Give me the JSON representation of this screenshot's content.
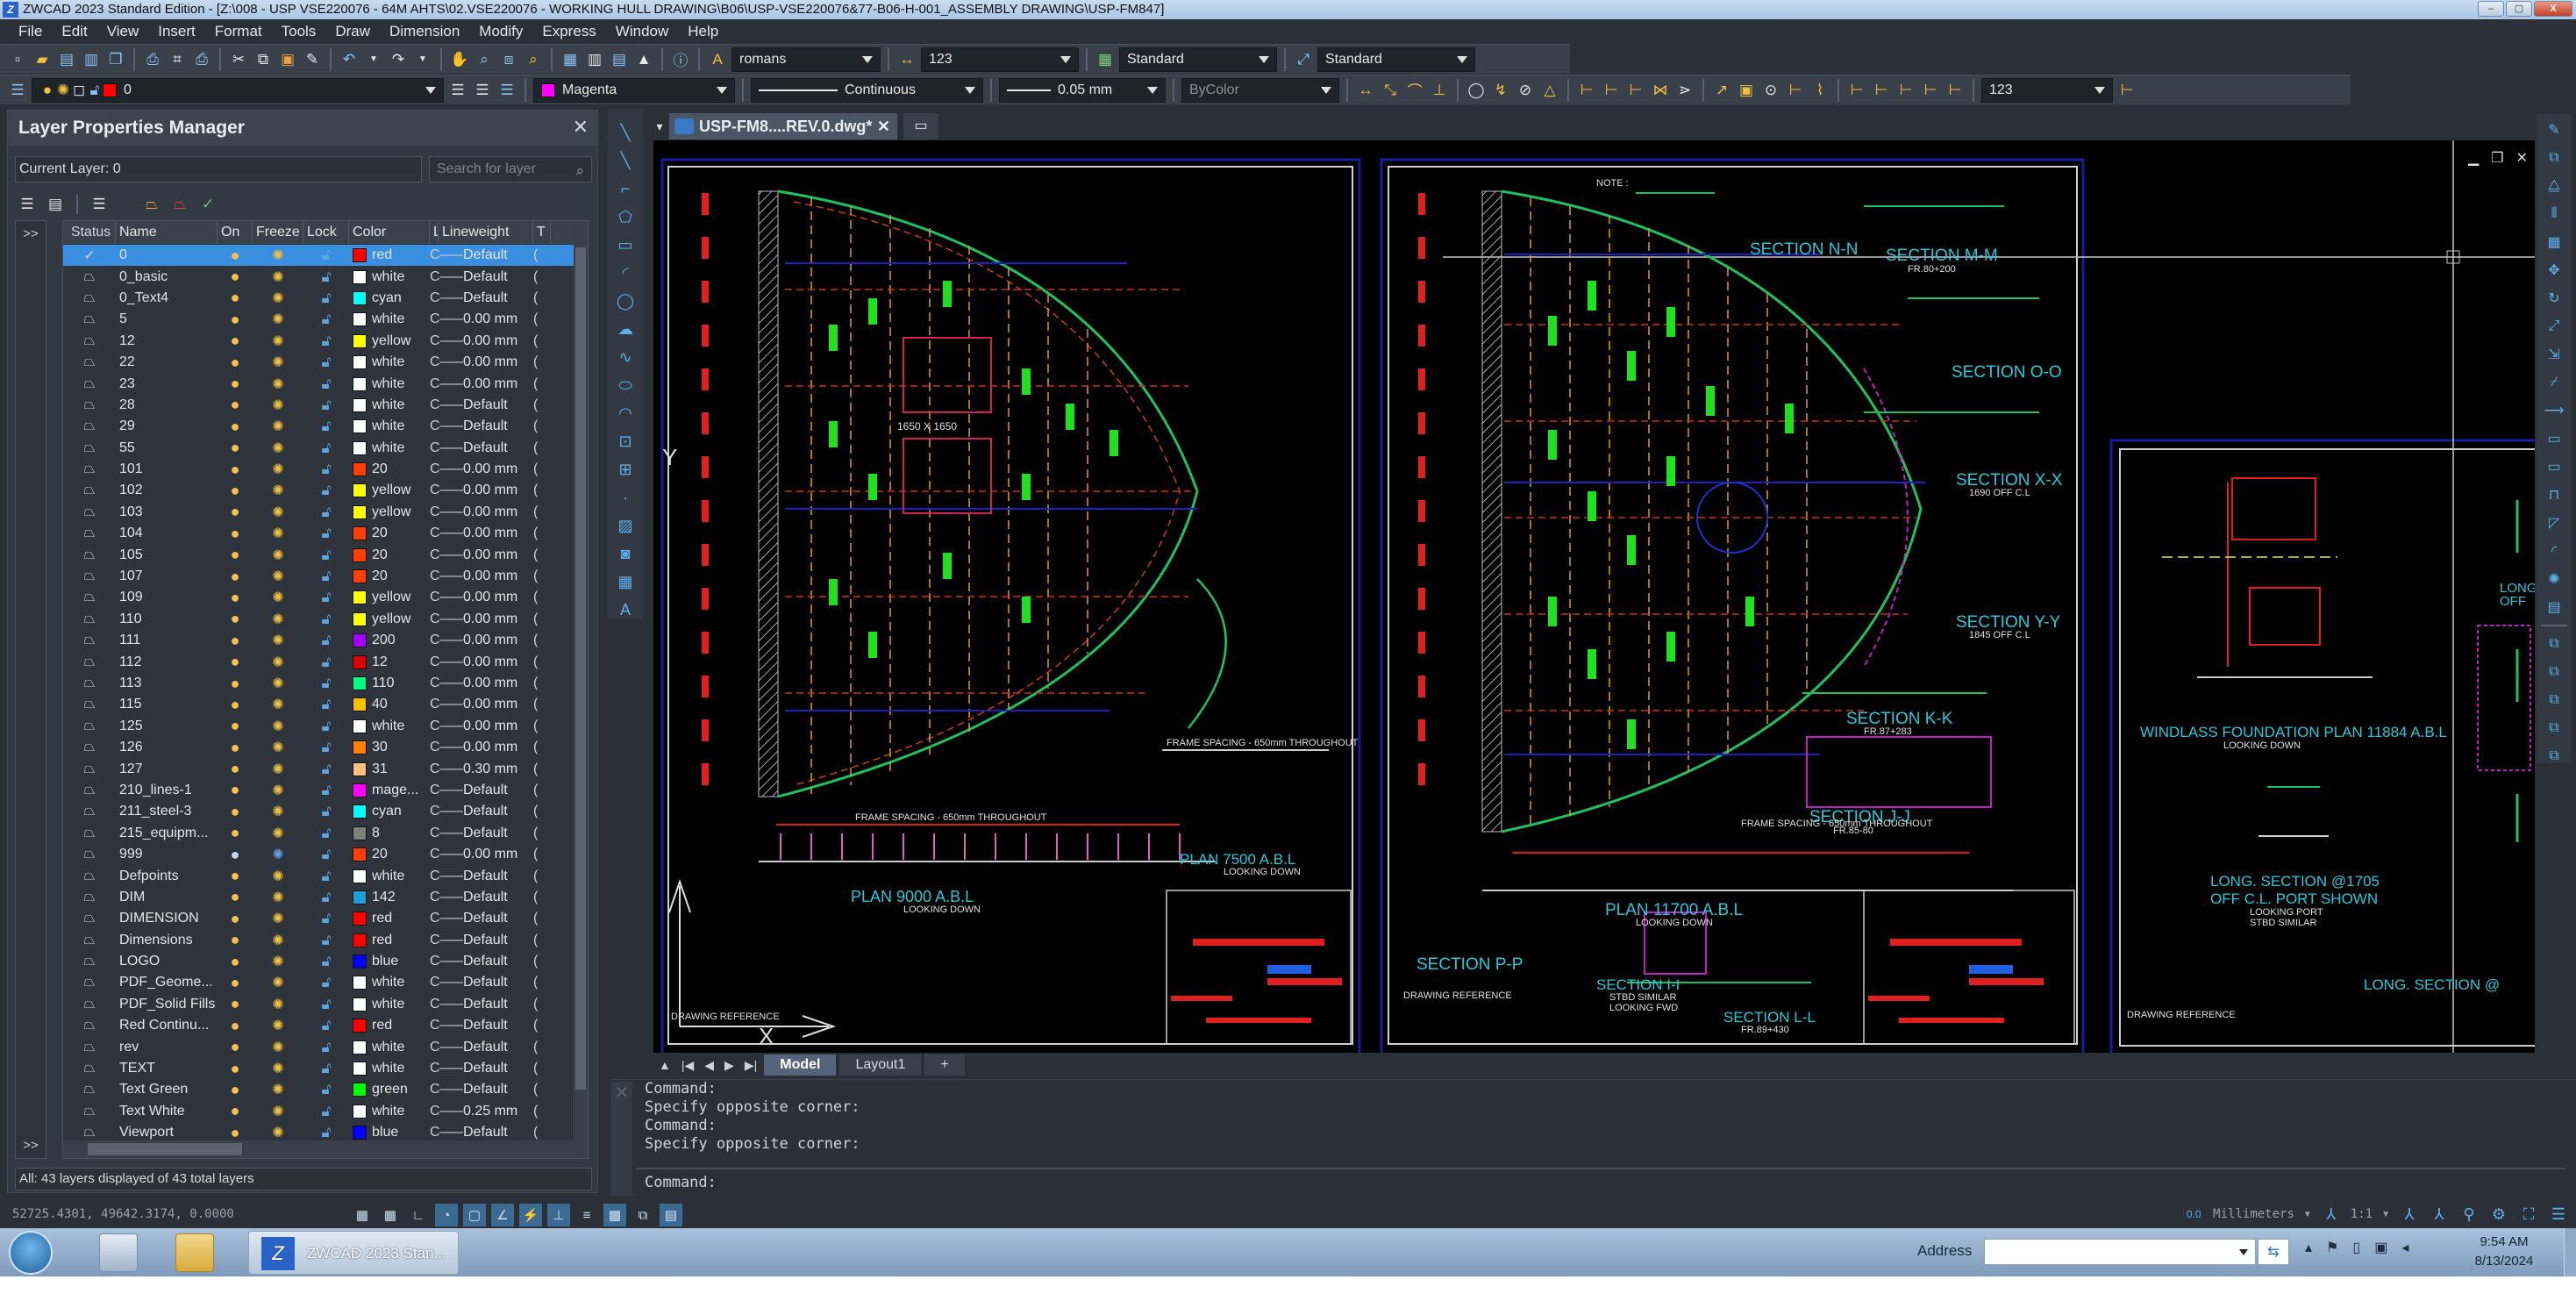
{
  "window": {
    "title": "ZWCAD 2023 Standard Edition - [Z:\\008 - USP VSE220076 - 64M AHTS\\02.VSE220076 - WORKING HULL DRAWING\\B06\\USP-VSE220076&77-B06-H-001_ASSEMBLY DRAWING\\USP-FM847]",
    "minimize": "–",
    "restore": "▢",
    "close": "X"
  },
  "menu": [
    "File",
    "Edit",
    "View",
    "Insert",
    "Format",
    "Tools",
    "Draw",
    "Dimension",
    "Modify",
    "Express",
    "Window",
    "Help"
  ],
  "toolbar1": {
    "text_style": "romans",
    "dim_style": "123",
    "table_style": "Standard",
    "mleader_style": "Standard"
  },
  "toolbar2": {
    "layer_combo": "0",
    "color_combo": "Magenta",
    "color_hex": "#ff00ff",
    "linetype_combo": "Continuous",
    "lineweight_combo": "0.05 mm",
    "plotstyle_combo": "ByColor",
    "dim_style2": "123"
  },
  "layer_panel": {
    "title": "Layer Properties Manager",
    "close": "✕",
    "current_layer": "Current Layer: 0",
    "search_placeholder": "Search for layer",
    "expand": ">>",
    "columns": [
      "Status",
      "Name",
      "On",
      "Freeze",
      "Lock",
      "Color",
      "Li",
      "Lineweight",
      "T"
    ],
    "footer": "All: 43 layers displayed of 43 total layers",
    "layers": [
      {
        "name": "0",
        "color": "red",
        "hex": "#ff0000",
        "lineweight": "Default",
        "current": true,
        "on": true
      },
      {
        "name": "0_basic",
        "color": "white",
        "hex": "#ffffff",
        "lineweight": "Default",
        "on": true
      },
      {
        "name": "0_Text4",
        "color": "cyan",
        "hex": "#00ffff",
        "lineweight": "Default",
        "on": true
      },
      {
        "name": "5",
        "color": "white",
        "hex": "#ffffff",
        "lineweight": "0.00 mm",
        "on": true
      },
      {
        "name": "12",
        "color": "yellow",
        "hex": "#ffff00",
        "lineweight": "0.00 mm",
        "on": true
      },
      {
        "name": "22",
        "color": "white",
        "hex": "#ffffff",
        "lineweight": "0.00 mm",
        "on": true
      },
      {
        "name": "23",
        "color": "white",
        "hex": "#ffffff",
        "lineweight": "0.00 mm",
        "on": true
      },
      {
        "name": "28",
        "color": "white",
        "hex": "#ffffff",
        "lineweight": "Default",
        "on": true
      },
      {
        "name": "29",
        "color": "white",
        "hex": "#ffffff",
        "lineweight": "Default",
        "on": true
      },
      {
        "name": "55",
        "color": "white",
        "hex": "#ffffff",
        "lineweight": "Default",
        "on": true
      },
      {
        "name": "101",
        "color": "20",
        "hex": "#ff3f00",
        "lineweight": "0.00 mm",
        "on": true
      },
      {
        "name": "102",
        "color": "yellow",
        "hex": "#ffff00",
        "lineweight": "0.00 mm",
        "on": true
      },
      {
        "name": "103",
        "color": "yellow",
        "hex": "#ffff00",
        "lineweight": "0.00 mm",
        "on": true
      },
      {
        "name": "104",
        "color": "20",
        "hex": "#ff3f00",
        "lineweight": "0.00 mm",
        "on": true
      },
      {
        "name": "105",
        "color": "20",
        "hex": "#ff3f00",
        "lineweight": "0.00 mm",
        "on": true
      },
      {
        "name": "107",
        "color": "20",
        "hex": "#ff3f00",
        "lineweight": "0.00 mm",
        "on": true
      },
      {
        "name": "109",
        "color": "yellow",
        "hex": "#ffff00",
        "lineweight": "0.00 mm",
        "on": true
      },
      {
        "name": "110",
        "color": "yellow",
        "hex": "#ffff00",
        "lineweight": "0.00 mm",
        "on": true
      },
      {
        "name": "111",
        "color": "200",
        "hex": "#a000ff",
        "lineweight": "0.00 mm",
        "on": true
      },
      {
        "name": "112",
        "color": "12",
        "hex": "#dd0000",
        "lineweight": "0.00 mm",
        "on": true
      },
      {
        "name": "113",
        "color": "110",
        "hex": "#00ff7f",
        "lineweight": "0.00 mm",
        "on": true
      },
      {
        "name": "115",
        "color": "40",
        "hex": "#ffbf00",
        "lineweight": "0.00 mm",
        "on": true
      },
      {
        "name": "125",
        "color": "white",
        "hex": "#ffffff",
        "lineweight": "0.00 mm",
        "on": true
      },
      {
        "name": "126",
        "color": "30",
        "hex": "#ff7f00",
        "lineweight": "0.00 mm",
        "on": true
      },
      {
        "name": "127",
        "color": "31",
        "hex": "#ffbf7f",
        "lineweight": "0.30 mm",
        "on": true
      },
      {
        "name": "210_lines-1",
        "color": "mage...",
        "hex": "#ff00ff",
        "lineweight": "Default",
        "on": true
      },
      {
        "name": "211_steel-3",
        "color": "cyan",
        "hex": "#00ffff",
        "lineweight": "Default",
        "on": true
      },
      {
        "name": "215_equipm...",
        "color": "8",
        "hex": "#808080",
        "lineweight": "Default",
        "on": true
      },
      {
        "name": "999",
        "color": "20",
        "hex": "#ff3f00",
        "lineweight": "0.00 mm",
        "on": false
      },
      {
        "name": "Defpoints",
        "color": "white",
        "hex": "#ffffff",
        "lineweight": "Default",
        "on": true
      },
      {
        "name": "DIM",
        "color": "142",
        "hex": "#1f9fd9",
        "lineweight": "Default",
        "on": true
      },
      {
        "name": "DIMENSION",
        "color": "red",
        "hex": "#ff0000",
        "lineweight": "Default",
        "on": true
      },
      {
        "name": "Dimensions",
        "color": "red",
        "hex": "#ff0000",
        "lineweight": "Default",
        "on": true
      },
      {
        "name": "LOGO",
        "color": "blue",
        "hex": "#0000ff",
        "lineweight": "Default",
        "on": true
      },
      {
        "name": "PDF_Geome...",
        "color": "white",
        "hex": "#ffffff",
        "lineweight": "Default",
        "on": true
      },
      {
        "name": "PDF_Solid Fills",
        "color": "white",
        "hex": "#ffffff",
        "lineweight": "Default",
        "on": true
      },
      {
        "name": "Red Continu...",
        "color": "red",
        "hex": "#ff0000",
        "lineweight": "Default",
        "on": true
      },
      {
        "name": "rev",
        "color": "white",
        "hex": "#ffffff",
        "lineweight": "Default",
        "on": true
      },
      {
        "name": "TEXT",
        "color": "white",
        "hex": "#ffffff",
        "lineweight": "Default",
        "on": true
      },
      {
        "name": "Text Green",
        "color": "green",
        "hex": "#00ff00",
        "lineweight": "Default",
        "on": true
      },
      {
        "name": "Text White",
        "color": "white",
        "hex": "#ffffff",
        "lineweight": "0.25 mm",
        "on": true
      },
      {
        "name": "Viewport",
        "color": "blue",
        "hex": "#0000ff",
        "lineweight": "Default",
        "on": true
      }
    ]
  },
  "document_tab": {
    "label": "USP-FM8....REV.0.dwg*",
    "close": "✕"
  },
  "drawing": {
    "note_title": "NOTE :",
    "labels_left_sheet": [
      "PLAN 9000 A.B.L",
      "LOOKING DOWN",
      "PLAN 7500 A.B.L",
      "LOOKING DOWN",
      "FRAME SPACING - 650mm THROUGHOUT",
      "DRAWING REFERENCE",
      "1650 X 1650"
    ],
    "labels_middle_sheet": [
      "SECTION N-N",
      "SECTION M-M",
      "FR.80+200",
      "SECTION O-O",
      "SECTION X-X",
      "1690 OFF C.L",
      "SECTION Y-Y",
      "1845 OFF C.L",
      "SECTION K-K",
      "FR.87+283",
      "SECTION J-J",
      "FR.85-80",
      "PLAN 11700 A.B.L",
      "LOOKING DOWN",
      "SECTION P-P",
      "SECTION I-I",
      "STBD SIMILAR",
      "LOOKING FWD",
      "SECTION L-L",
      "FR.89+430",
      "DRAWING REFERENCE"
    ],
    "labels_right_sheet": [
      "WINDLASS FOUNDATION PLAN 11884 A.B.L",
      "LOOKING DOWN",
      "LONG. SECTION @1705",
      "OFF C.L. PORT SHOWN",
      "LOOKING PORT",
      "STBD SIMILAR",
      "LONG. SECTION @",
      "LONG",
      "OFF",
      "DRAWING REFERENCE"
    ],
    "ucs_x": "X",
    "ucs_y": "Y"
  },
  "layout_tabs": [
    "Model",
    "Layout1",
    "+"
  ],
  "command": {
    "history": [
      "Command:",
      "Specify opposite corner:",
      "Command:",
      "Specify opposite corner:"
    ],
    "prompt": "Command:"
  },
  "statusbar": {
    "coords": "52725.4301, 49642.3174, 0.0000",
    "units": "Millimeters",
    "scale": "1:1"
  },
  "taskbar": {
    "app_label": "ZWCAD 2023 Stan...",
    "address_label": "Address",
    "address_value": "",
    "time": "9:54 AM",
    "date": "8/13/2024"
  }
}
